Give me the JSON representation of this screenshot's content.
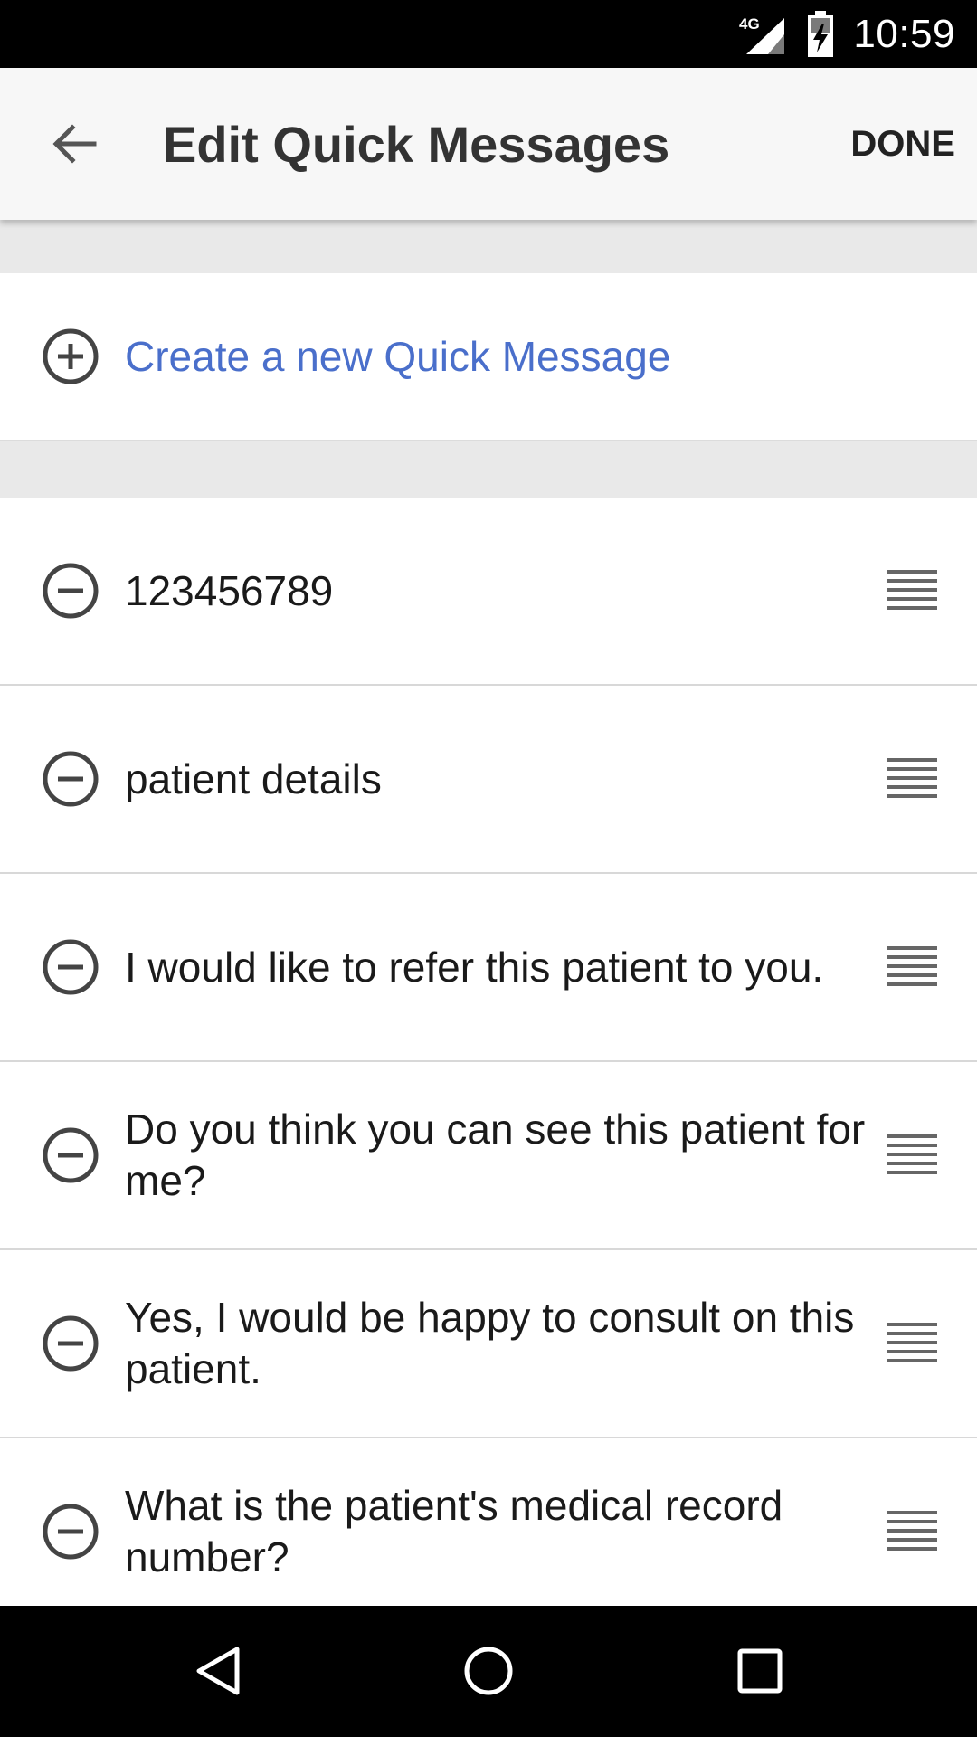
{
  "status_bar": {
    "network": "4G",
    "time": "10:59",
    "colors": {
      "background": "#000000",
      "foreground": "#ffffff"
    },
    "icons": [
      "signal-icon",
      "battery-icon"
    ]
  },
  "app_bar": {
    "title": "Edit Quick Messages",
    "done_label": "DONE",
    "back_icon": "arrow-back-icon"
  },
  "create": {
    "label": "Create a new Quick Message",
    "icon": "add-circle-icon",
    "color": "#4a6fcb"
  },
  "messages": [
    {
      "text": "123456789"
    },
    {
      "text": "patient details"
    },
    {
      "text": "I would like to refer this patient to you."
    },
    {
      "text": "Do you think you can see this patient for me?"
    },
    {
      "text": "Yes, I would be happy to consult on this patient."
    },
    {
      "text": "What is the patient's medical record number?"
    }
  ],
  "message_row_icons": {
    "remove": "remove-circle-icon",
    "reorder": "drag-handle-icon"
  },
  "nav_bar": {
    "icons": [
      "back-triangle-icon",
      "home-circle-icon",
      "recents-square-icon"
    ]
  }
}
